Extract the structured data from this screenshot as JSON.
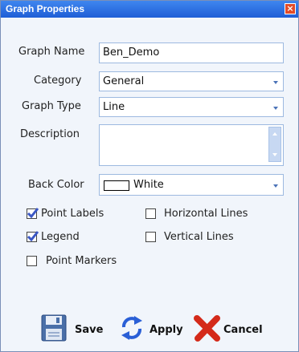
{
  "window": {
    "title": "Graph Properties"
  },
  "form": {
    "graph_name_label": "Graph Name",
    "graph_name_value": "Ben_Demo",
    "category_label": "Category",
    "category_value": "General",
    "graph_type_label": "Graph Type",
    "graph_type_value": "Line",
    "description_label": "Description",
    "description_value": "",
    "back_color_label": "Back Color",
    "back_color_value": "White"
  },
  "options": [
    {
      "label": "Point Labels",
      "checked": true
    },
    {
      "label": "Horizontal Lines",
      "checked": false
    },
    {
      "label": "Legend",
      "checked": true
    },
    {
      "label": "Vertical Lines",
      "checked": false
    },
    {
      "label": "Point Markers",
      "checked": false
    }
  ],
  "buttons": {
    "save": "Save",
    "apply": "Apply",
    "cancel": "Cancel"
  },
  "colors": {
    "titlebar": "#2f6fe6",
    "panel": "#f1f5fb",
    "field_border": "#9db9e0",
    "check": "#3a57c4",
    "cancel_x": "#d42a1a",
    "apply_arrows": "#2a5fd6"
  },
  "icons": {
    "close": "close-icon",
    "save": "floppy-disk-icon",
    "apply": "refresh-arrows-icon",
    "cancel": "red-x-icon",
    "dropdown": "chevron-down-icon"
  }
}
